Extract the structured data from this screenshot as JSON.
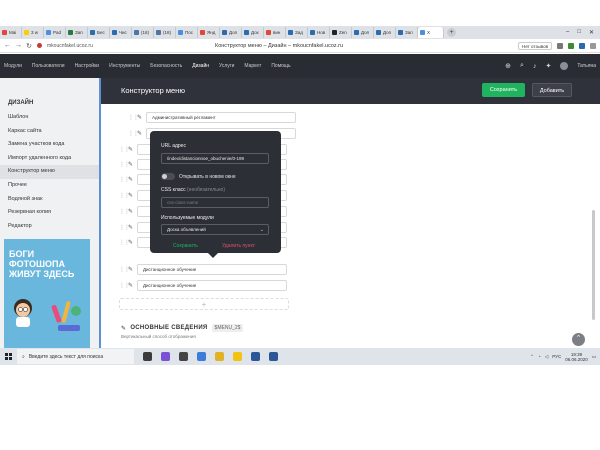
{
  "browser": {
    "tabs": [
      {
        "label": "Mai",
        "color": "#e2453c"
      },
      {
        "label": "3 w",
        "color": "#ffcc00"
      },
      {
        "label": "Pad",
        "color": "#4a90e2"
      },
      {
        "label": "Зап",
        "color": "#2b7a3d"
      },
      {
        "label": "Бес",
        "color": "#2b6cb0"
      },
      {
        "label": "Чис",
        "color": "#2b6cb0"
      },
      {
        "label": "(18)",
        "color": "#4a76a8"
      },
      {
        "label": "(18)",
        "color": "#4a76a8"
      },
      {
        "label": "Пос",
        "color": "#4a90e2"
      },
      {
        "label": "Янд",
        "color": "#e2453c"
      },
      {
        "label": "Доп",
        "color": "#2b6cb0"
      },
      {
        "label": "Дох",
        "color": "#2b6cb0"
      },
      {
        "label": "вин",
        "color": "#e2453c"
      },
      {
        "label": "Зад",
        "color": "#2b6cb0"
      },
      {
        "label": "Нов",
        "color": "#2b6cb0"
      },
      {
        "label": "Zen",
        "color": "#222222"
      },
      {
        "label": "Доп",
        "color": "#2b6cb0"
      },
      {
        "label": "Доп",
        "color": "#2b6cb0"
      },
      {
        "label": "Зап",
        "color": "#2b6cb0"
      },
      {
        "label": "X",
        "color": "#4a90e2",
        "active": true
      }
    ],
    "new_tab": "+",
    "window_controls": [
      "–",
      "□",
      "✕"
    ],
    "url": "mkoucnfakel.ucoz.ru",
    "page_title": "Конструктор меню – Дизайн – mkoucnfakel.ucoz.ru",
    "feedback_label": "Нет отзывов"
  },
  "topmenu": {
    "items": [
      "Модули",
      "Пользователи",
      "Настройки",
      "Инструменты",
      "Безопасность",
      "Дизайн",
      "Услуги",
      "Маркет",
      "Помощь"
    ],
    "active_index": 5,
    "user_name": "Татьяна"
  },
  "sidebar": {
    "heading": "ДИЗАЙН",
    "items": [
      "Шаблон",
      "Каркас сайта",
      "Замена участков кода",
      "Импорт удаленного кода",
      "Конструктор меню",
      "Прочее",
      "Водяной знак",
      "Резервная копия",
      "Редактор"
    ],
    "active_index": 4,
    "banner_text": [
      "БОГИ",
      "ФОТОШОПА",
      "ЖИВУТ ЗДЕСЬ"
    ]
  },
  "constructor": {
    "title": "Конструктор меню",
    "save_label": "Сохранить",
    "add_label": "Добавить"
  },
  "menu_items": [
    {
      "label": "Административный регламент"
    },
    {
      "label": ""
    },
    {
      "label": ""
    },
    {
      "label": ""
    },
    {
      "label": ""
    },
    {
      "label": ""
    },
    {
      "label": ""
    },
    {
      "label": ""
    },
    {
      "label": ""
    },
    {
      "label": "Дистанционное обучение"
    },
    {
      "label": "Дистанционное обучение"
    }
  ],
  "add_row_symbol": "+",
  "section": {
    "title": "ОСНОВНЫЕ СВЕДЕНИЯ",
    "badge": "$MENU_2$",
    "subtitle": "Вертикальный способ отображения"
  },
  "popup": {
    "url_label": "URL адрес",
    "url_value": "/index/distancionnoe_obuchenie/0-199",
    "toggle_label": "Открывать в новом окне",
    "toggle_on": false,
    "css_label": "CSS класс",
    "css_optional": "(необязательно)",
    "css_placeholder": "css-class-name",
    "modules_label": "Используемые модули",
    "modules_value": "Доска объявлений",
    "save_label": "Сохранить",
    "delete_label": "Удалить пункт"
  },
  "taskbar": {
    "search_placeholder": "Введите здесь текст для поиска",
    "time": "19:39",
    "date": "06.06.2020",
    "lang": "РУС",
    "app_colors": [
      "#3b3b3b",
      "#7b4fd6",
      "#444444",
      "#3b7dd8",
      "#e0b324",
      "#f1c40f",
      "#2b5797",
      "#2b5797"
    ]
  },
  "colors": {
    "accent_green": "#20b45f",
    "danger": "#e0506a",
    "header_dark": "#2f323a"
  }
}
